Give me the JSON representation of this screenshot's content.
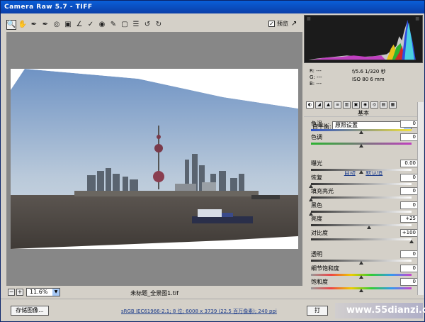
{
  "window": {
    "title": "Camera Raw 5.7 -  TIFF"
  },
  "toolbar": {
    "tools": [
      "zoom-tool-icon",
      "hand-tool-icon",
      "white-balance-icon",
      "color-sampler-icon",
      "target-adjust-icon",
      "crop-icon",
      "straighten-icon",
      "spot-removal-icon",
      "red-eye-icon",
      "adjustment-brush-icon",
      "graduated-filter-icon",
      "preferences-icon",
      "rotate-ccw-icon",
      "rotate-cw-icon"
    ],
    "preview_label": "预览",
    "preview_checked": "✓"
  },
  "status": {
    "zoom_value": "11.6%",
    "filename": "未标题_全景图1.tif"
  },
  "bottom": {
    "save_label": "存储图像...",
    "info_text": "sRGB IEC61966-2.1; 8 位; 6008 x 3739 (22.5 百万像素); 240 ppi",
    "open_label": "打"
  },
  "watermark": "www.55dianzi.com",
  "readout": {
    "r": "R:  ---",
    "g": "G:  ---",
    "b": "B:  ---",
    "exif_line1": "f/5.6   1/320 秒",
    "exif_line2": "ISO 80   6 mm"
  },
  "panel": {
    "section_title": "基本",
    "wb_label": "白平衡:",
    "wb_value": "原照设置",
    "auto_label": "自动",
    "default_label": "默认值",
    "sliders": [
      {
        "key": "temp",
        "label": "色温",
        "value": "0",
        "level": 0.5
      },
      {
        "key": "tint",
        "label": "色调",
        "value": "0",
        "level": 0.5
      },
      {
        "key": "exposure",
        "label": "曝光",
        "value": "0.00",
        "level": 0.5
      },
      {
        "key": "recovery",
        "label": "恢复",
        "value": "0",
        "level": 0.0
      },
      {
        "key": "fill",
        "label": "填充亮光",
        "value": "0",
        "level": 0.0
      },
      {
        "key": "blacks",
        "label": "黑色",
        "value": "0",
        "level": 0.0
      },
      {
        "key": "brightness",
        "label": "亮度",
        "value": "+25",
        "level": 0.58
      },
      {
        "key": "contrast",
        "label": "对比度",
        "value": "+100",
        "level": 1.0
      },
      {
        "key": "clarity",
        "label": "透明",
        "value": "0",
        "level": 0.5
      },
      {
        "key": "vibrance",
        "label": "细节饱和度",
        "value": "0",
        "level": 0.5
      },
      {
        "key": "saturation",
        "label": "饱和度",
        "value": "0",
        "level": 0.5
      }
    ]
  },
  "colors": {
    "titlebar": "#0a3ea8",
    "panel_bg": "#d4d0c8",
    "canvas_bg": "#878787"
  }
}
